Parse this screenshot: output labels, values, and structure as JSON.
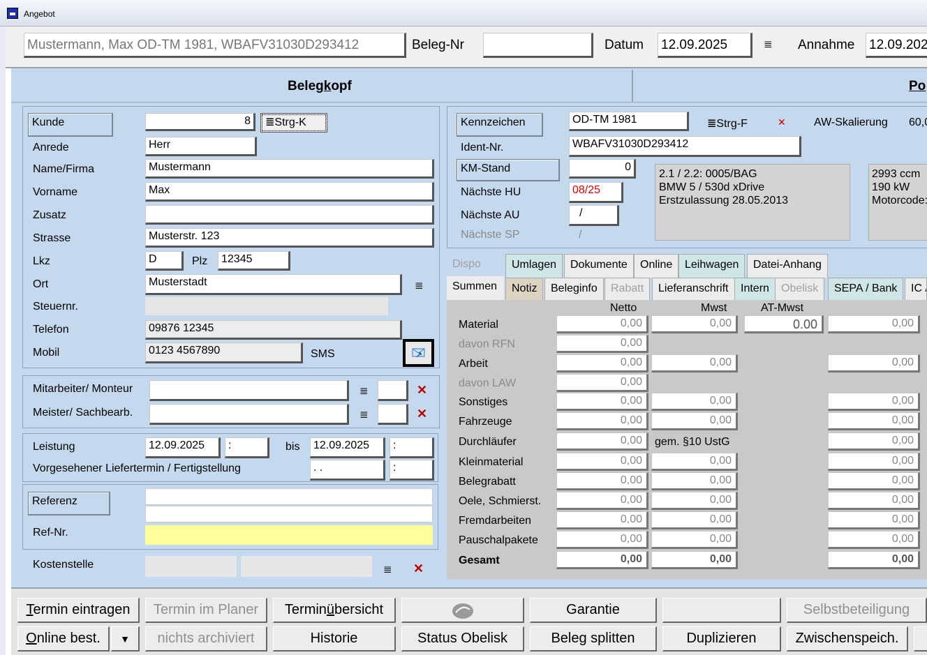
{
  "window": {
    "title": "Angebot"
  },
  "top": {
    "customer_vehicle": "Mustermann, Max OD-TM 1981, WBAFV31030D293412",
    "beleg_nr_label": "Beleg-Nr",
    "beleg_nr_value": "",
    "datum_label": "Datum",
    "datum_value": "12.09.2025",
    "annahme_label": "Annahme",
    "annahme_value": "12.09.202"
  },
  "main_tabs": {
    "belegkopf": "Belegkopf",
    "positionen": "Po"
  },
  "kunde": {
    "kunde_label": "Kunde",
    "kunde_value": "8",
    "strgk_label": "Strg-K",
    "anrede_label": "Anrede",
    "anrede_value": "Herr",
    "name_label": "Name/Firma",
    "name_value": "Mustermann",
    "vorname_label": "Vorname",
    "vorname_value": "Max",
    "zusatz_label": "Zusatz",
    "zusatz_value": "",
    "strasse_label": "Strasse",
    "strasse_value": "Musterstr. 123",
    "lkz_label": "Lkz",
    "lkz_value": "D",
    "plz_label": "Plz",
    "plz_value": "12345",
    "ort_label": "Ort",
    "ort_value": "Musterstadt",
    "steuernr_label": "Steuernr.",
    "steuernr_value": "",
    "telefon_label": "Telefon",
    "telefon_value": "09876 12345",
    "mobil_label": "Mobil",
    "mobil_value": "0123 4567890",
    "sms_label": "SMS"
  },
  "staff": {
    "mitarbeiter_label": "Mitarbeiter/ Monteur",
    "meister_label": "Meister/ Sachbearb."
  },
  "leistung": {
    "leistung_label": "Leistung",
    "from_date": "12.09.2025",
    "from_time": ":",
    "bis_label": "bis",
    "to_date": "12.09.2025",
    "to_time": ":",
    "liefertermin_label": "Vorgesehener Liefertermin / Fertigstellung",
    "liefer_date": " .  .",
    "liefer_time": ":"
  },
  "referenz": {
    "referenz_label": "Referenz",
    "refnr_label": "Ref-Nr.",
    "kostenstelle_label": "Kostenstelle"
  },
  "fahrzeug": {
    "kennzeichen_label": "Kennzeichen",
    "kennzeichen_value": "OD-TM 1981",
    "strgf_label": "Strg-F",
    "aw_label": "AW-Skalierung",
    "aw_value": "60,0",
    "ident_label": "Ident-Nr.",
    "ident_value": "WBAFV31030D293412",
    "km_label": "KM-Stand",
    "km_value": "0",
    "hu_label": "Nächste HU",
    "hu_value": "08/25",
    "au_label": "Nächste AU",
    "au_value": "/",
    "sp_label": "Nächste SP",
    "sp_value": "/",
    "info_line1": "2.1 / 2.2: 0005/BAG",
    "info_line2": "BMW 5 / 530d xDrive",
    "info_line3": "Erstzulassung 28.05.2013",
    "tech_line1": "2993 ccm",
    "tech_line2": "190 kW",
    "tech_line3": "Motorcode:"
  },
  "tabs_row1": [
    "Dispo",
    "Umlagen",
    "Dokumente",
    "Online",
    "Leihwagen",
    "Datei-Anhang"
  ],
  "tabs_row2": [
    "Summen",
    "Notiz",
    "Beleginfo",
    "Rabatt",
    "Lieferanschrift",
    "Intern",
    "Obelisk",
    "SEPA / Bank",
    "IC /"
  ],
  "summen": {
    "col_netto": "Netto",
    "col_mwst": "Mwst",
    "col_atmwst": "AT-Mwst",
    "rows": [
      {
        "label": "Material",
        "netto": "0,00",
        "mwst": "0,00",
        "at": "0.00",
        "total": "0,00"
      },
      {
        "label": "davon RFN",
        "netto": "0,00"
      },
      {
        "label": "Arbeit",
        "netto": "0,00",
        "mwst": "0,00",
        "total": "0,00"
      },
      {
        "label": "davon LAW",
        "netto": "0,00"
      },
      {
        "label": "Sonstiges",
        "netto": "0,00",
        "mwst": "0,00",
        "total": "0,00"
      },
      {
        "label": "Fahrzeuge",
        "netto": "0,00",
        "mwst": "0,00",
        "total": "0,00"
      },
      {
        "label": "Durchläufer",
        "netto": "0,00",
        "note": "gem. §10 UstG",
        "total": "0,00"
      },
      {
        "label": "Kleinmaterial",
        "netto": "0,00",
        "mwst": "0,00",
        "total": "0,00"
      },
      {
        "label": "Belegrabatt",
        "netto": "0,00",
        "mwst": "0,00",
        "total": "0,00"
      },
      {
        "label": "Oele, Schmierst.",
        "netto": "0,00",
        "mwst": "0,00",
        "total": "0,00"
      },
      {
        "label": "Fremdarbeiten",
        "netto": "0,00",
        "mwst": "0,00",
        "total": "0,00"
      },
      {
        "label": "Pauschalpakete",
        "netto": "0,00",
        "mwst": "0,00",
        "total": "0,00"
      },
      {
        "label": "Gesamt",
        "netto": "0,00",
        "mwst": "0,00",
        "total": "0,00"
      }
    ]
  },
  "buttons_row1": [
    "Termin eintragen",
    "Termin im Planer",
    "Terminübersicht",
    "",
    "Garantie",
    "",
    "Selbstbeteiligung"
  ],
  "buttons_row2": [
    "Online best.",
    "nichts archiviert",
    "Historie",
    "Status Obelisk",
    "Beleg splitten",
    "Duplizieren",
    "Zwischenspeich."
  ]
}
